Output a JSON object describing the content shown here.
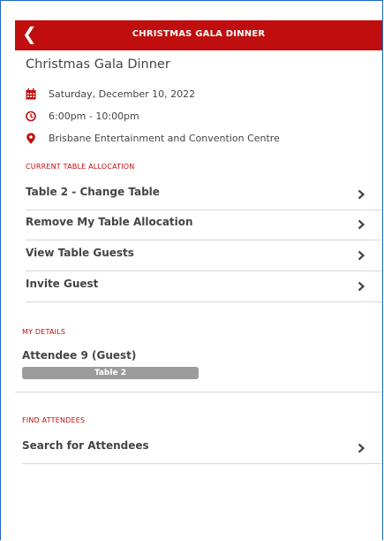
{
  "header": {
    "title": "CHRISTMAS GALA DINNER",
    "back_glyph": "❮"
  },
  "event": {
    "name": "Christmas Gala Dinner",
    "date": "Saturday, December 10, 2022",
    "time": "6:00pm - 10:00pm",
    "venue": "Brisbane Entertainment and Convention Centre"
  },
  "table_allocation": {
    "section_label": "CURRENT TABLE ALLOCATION",
    "items": [
      {
        "label": "Table 2 - Change Table"
      },
      {
        "label": "Remove My Table Allocation"
      },
      {
        "label": "View Table Guests"
      },
      {
        "label": "Invite Guest"
      }
    ]
  },
  "my_details": {
    "section_label": "MY DETAILS",
    "attendee": "Attendee 9 (Guest)",
    "table_badge": "Table 2"
  },
  "find_attendees": {
    "section_label": "FIND ATTENDEES",
    "items": [
      {
        "label": "Search for Attendees"
      }
    ]
  },
  "icons": {
    "calendar": "calendar-icon",
    "clock": "clock-icon",
    "location": "map-pin-icon",
    "chevron": "chevron-right-icon"
  },
  "colors": {
    "accent": "#c00d0d",
    "badge": "#9c9c9c",
    "frame": "#1e66c8"
  }
}
